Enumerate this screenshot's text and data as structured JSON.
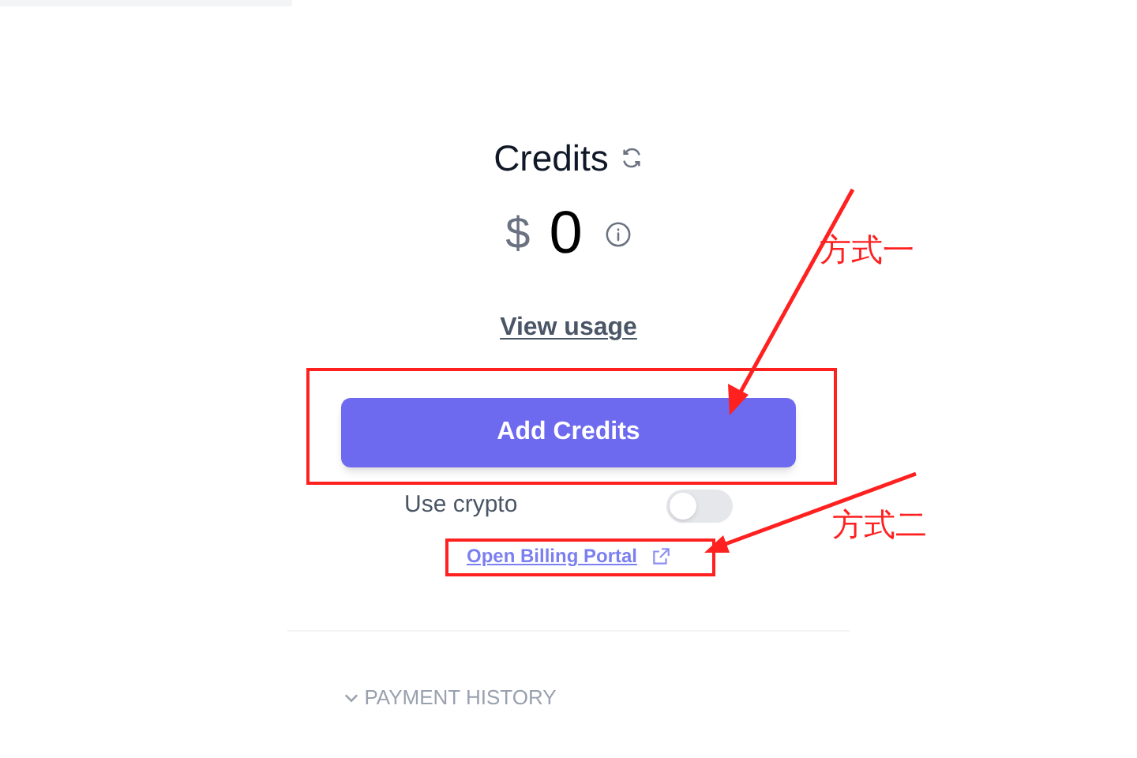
{
  "credits": {
    "title": "Credits",
    "currency": "$",
    "amount": "0",
    "view_usage": "View usage",
    "add_button": "Add Credits",
    "crypto": {
      "label": "Use crypto",
      "on": false
    },
    "billing_link": "Open Billing Portal",
    "payment_history": "PAYMENT HISTORY"
  },
  "annotations": [
    {
      "label": "方式一"
    },
    {
      "label": "方式二"
    }
  ]
}
